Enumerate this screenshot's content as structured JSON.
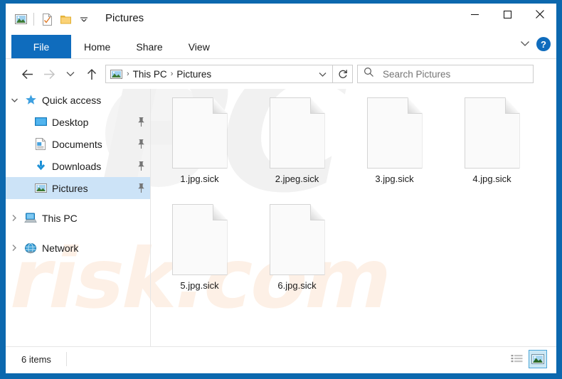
{
  "window": {
    "title": "Pictures",
    "accent_color": "#0c68ae",
    "selection_color": "#cce3f7",
    "quick_access_toolbar": [
      {
        "name": "pictures-icon",
        "label": "Pictures"
      },
      {
        "name": "properties-icon",
        "label": "Properties"
      },
      {
        "name": "new-folder-icon",
        "label": "New folder"
      },
      {
        "name": "customize-chevron-icon",
        "label": "Customize Quick Access Toolbar"
      }
    ],
    "controls": {
      "minimize": "—",
      "maximize": "☐",
      "close": "✕"
    }
  },
  "ribbon": {
    "tabs": [
      {
        "label": "File",
        "active": true
      },
      {
        "label": "Home",
        "active": false
      },
      {
        "label": "Share",
        "active": false
      },
      {
        "label": "View",
        "active": false
      }
    ],
    "expand_label": "⌄",
    "help_label": "?"
  },
  "navigation": {
    "back_label": "←",
    "forward_label": "→",
    "recent_label": "⌄",
    "up_label": "↑",
    "refresh_label": "↻",
    "address_dropdown_label": "⌄",
    "breadcrumbs": [
      "This PC",
      "Pictures"
    ],
    "separator": "›"
  },
  "search": {
    "placeholder": "Search Pictures",
    "value": "",
    "icon": "search-icon"
  },
  "sidebar": {
    "items": [
      {
        "label": "Quick access",
        "level": 1,
        "icon": "star-icon",
        "chevron": "⌄",
        "expanded": true,
        "pinned": false,
        "selected": false
      },
      {
        "label": "Desktop",
        "level": 2,
        "icon": "desktop-icon",
        "chevron": "",
        "pinned": true,
        "selected": false
      },
      {
        "label": "Documents",
        "level": 2,
        "icon": "documents-icon",
        "chevron": "",
        "pinned": true,
        "selected": false
      },
      {
        "label": "Downloads",
        "level": 2,
        "icon": "downloads-icon",
        "chevron": "",
        "pinned": true,
        "selected": false
      },
      {
        "label": "Pictures",
        "level": 2,
        "icon": "pictures-icon",
        "chevron": "",
        "pinned": true,
        "selected": true
      },
      {
        "label": "This PC",
        "level": 1,
        "icon": "this-pc-icon",
        "chevron": "›",
        "expanded": false,
        "pinned": false,
        "selected": false
      },
      {
        "label": "Network",
        "level": 1,
        "icon": "network-icon",
        "chevron": "›",
        "expanded": false,
        "pinned": false,
        "selected": false
      }
    ]
  },
  "files": [
    {
      "name": "1.jpg.sick",
      "icon": "blank-file-icon"
    },
    {
      "name": "2.jpeg.sick",
      "icon": "blank-file-icon"
    },
    {
      "name": "3.jpg.sick",
      "icon": "blank-file-icon"
    },
    {
      "name": "4.jpg.sick",
      "icon": "blank-file-icon"
    },
    {
      "name": "5.jpg.sick",
      "icon": "blank-file-icon"
    },
    {
      "name": "6.jpg.sick",
      "icon": "blank-file-icon"
    }
  ],
  "statusbar": {
    "item_count_text": "6 items",
    "views": [
      {
        "name": "details-view-button",
        "active": false
      },
      {
        "name": "large-icons-view-button",
        "active": true
      }
    ]
  },
  "watermark": {
    "big_text": "PC",
    "small_text": "risk.com"
  }
}
